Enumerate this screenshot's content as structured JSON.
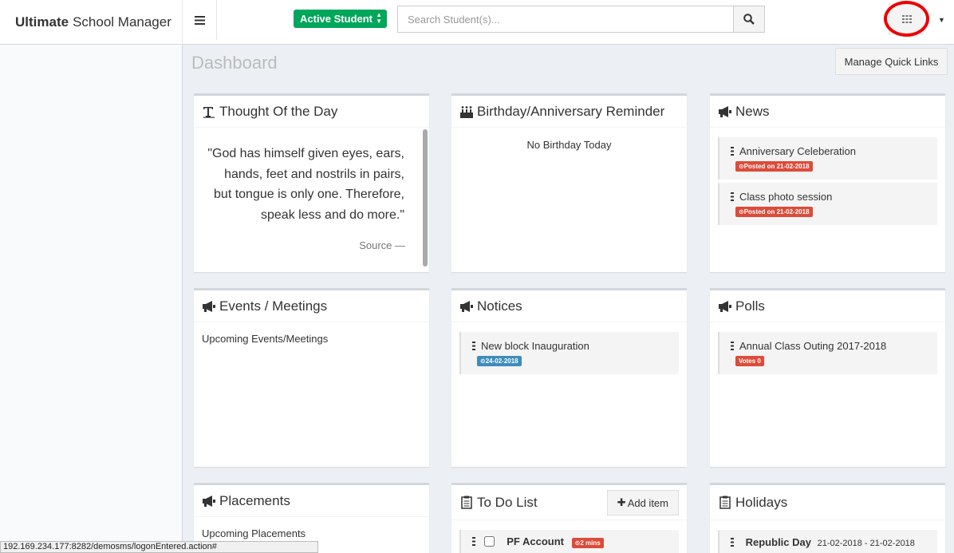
{
  "brand": {
    "bold": "Ultimate",
    "rest": "School Manager"
  },
  "topbar": {
    "student_filter": "Active Student",
    "search_placeholder": "Search Student(s)..."
  },
  "page": {
    "title": "Dashboard",
    "quick_links": "Manage Quick Links"
  },
  "thought": {
    "title": "Thought Of the Day",
    "quote": "\"God has himself given eyes, ears, hands, feet and nostrils in pairs, but tongue is only one. Therefore, speak less and do more.\"",
    "source": "Source —"
  },
  "birthday": {
    "title": "Birthday/Anniversary Reminder",
    "empty": "No Birthday Today"
  },
  "news": {
    "title": "News",
    "items": [
      {
        "label": "Anniversary Celeberation",
        "badge": "Posted on 21-02-2018"
      },
      {
        "label": "Class photo session",
        "badge": "Posted on 21-02-2018"
      }
    ]
  },
  "events": {
    "title": "Events / Meetings",
    "body": "Upcoming Events/Meetings"
  },
  "notices": {
    "title": "Notices",
    "items": [
      {
        "label": "New block Inauguration",
        "badge": "24-02-2018"
      }
    ]
  },
  "polls": {
    "title": "Polls",
    "items": [
      {
        "label": "Annual Class Outing 2017-2018",
        "badge": "Votes 0"
      }
    ]
  },
  "placements": {
    "title": "Placements",
    "body": "Upcoming Placements"
  },
  "todo": {
    "title": "To Do List",
    "add": "Add item",
    "items": [
      {
        "label": "PF Account",
        "badge": "2 mins"
      }
    ]
  },
  "holidays": {
    "title": "Holidays",
    "items": [
      {
        "label": "Republic Day",
        "dates": "21-02-2018 - 21-02-2018"
      }
    ]
  },
  "statusbar": "192.169.234.177:8282/demosms/logonEntered.action#"
}
